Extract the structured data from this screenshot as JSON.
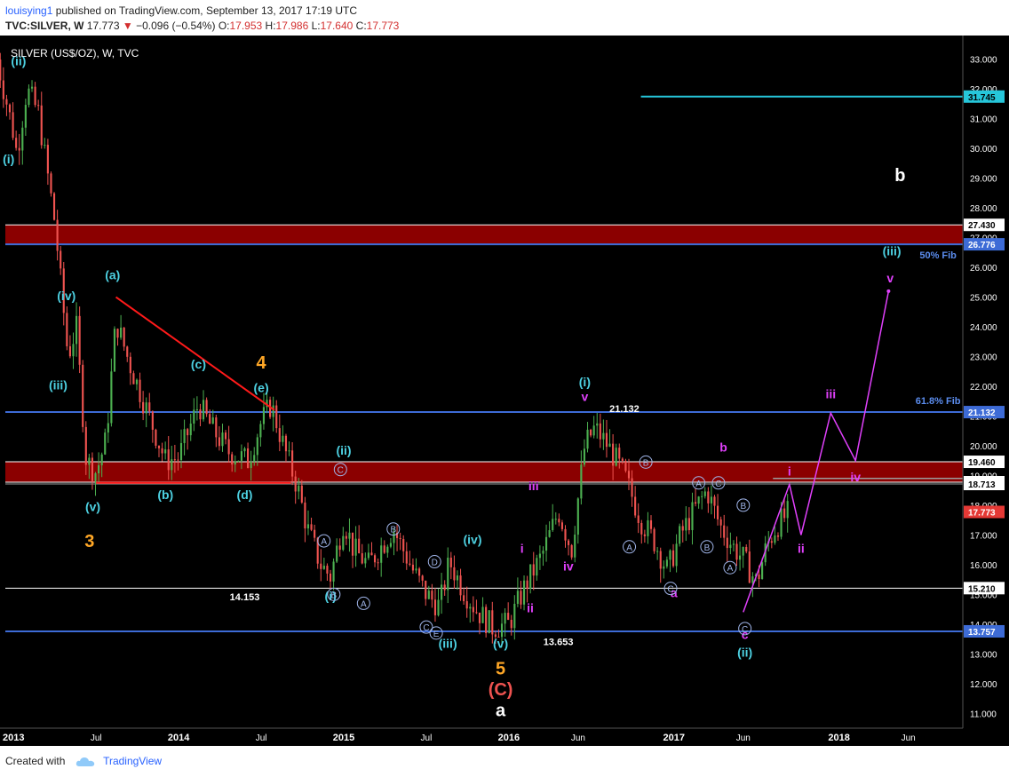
{
  "header": {
    "user": "louisying1",
    "published": "published on TradingView.com, September 13, 2017 17:19 UTC",
    "symbol": "TVC:SILVER, W",
    "last": "17.773",
    "change": "−0.096 (−0.54%)",
    "open_label": "O:",
    "open": "17.953",
    "high_label": "H:",
    "high": "17.986",
    "low_label": "L:",
    "low": "17.640",
    "close_label": "C:",
    "close": "17.773"
  },
  "footer": {
    "created_with": "Created with",
    "brand": "TradingView",
    "logo_icon": "tradingview-cloud-icon"
  },
  "colors": {
    "background": "#000000",
    "axis_text": "#ffffff",
    "up_candle": "#4caf50",
    "down_candle": "#ef5350",
    "wave_cyan": "#4dd0e1",
    "wave_magenta": "#e040fb",
    "wave_orange": "#ffa726",
    "wave_red": "#ef5350",
    "fib_blue": "#3d6bd6",
    "resistance_zone": "#8b0000",
    "trendline": "#ff1a1a",
    "target_line": "#26c6da"
  },
  "chart_data": {
    "type": "candlestick",
    "title": "SILVER (US$/OZ), W, TVC",
    "ylim": [
      10.5,
      33.5
    ],
    "y_ticks": [
      "11.000",
      "12.000",
      "13.000",
      "14.000",
      "15.000",
      "16.000",
      "17.000",
      "18.000",
      "19.000",
      "20.000",
      "21.000",
      "22.000",
      "23.000",
      "24.000",
      "25.000",
      "26.000",
      "27.000",
      "28.000",
      "29.000",
      "30.000",
      "31.000",
      "32.000",
      "33.000"
    ],
    "x_ticks": [
      {
        "label": "2013",
        "t": 2013.0
      },
      {
        "label": "Jul",
        "t": 2013.5
      },
      {
        "label": "2014",
        "t": 2014.0
      },
      {
        "label": "Jul",
        "t": 2014.5
      },
      {
        "label": "2015",
        "t": 2015.0
      },
      {
        "label": "Jul",
        "t": 2015.5
      },
      {
        "label": "2016",
        "t": 2016.0
      },
      {
        "label": "Jun",
        "t": 2016.42
      },
      {
        "label": "2017",
        "t": 2017.0
      },
      {
        "label": "Jun",
        "t": 2017.42
      },
      {
        "label": "2018",
        "t": 2018.0
      },
      {
        "label": "Jun",
        "t": 2018.42
      }
    ],
    "price_path": [
      [
        2012.9,
        33.0
      ],
      [
        2013.0,
        30.5
      ],
      [
        2013.02,
        29.8
      ],
      [
        2013.08,
        32.0
      ],
      [
        2013.15,
        31.2
      ],
      [
        2013.25,
        27.5
      ],
      [
        2013.33,
        23.0
      ],
      [
        2013.38,
        24.0
      ],
      [
        2013.44,
        19.5
      ],
      [
        2013.5,
        19.1
      ],
      [
        2013.56,
        20.2
      ],
      [
        2013.62,
        24.2
      ],
      [
        2013.7,
        22.8
      ],
      [
        2013.8,
        21.3
      ],
      [
        2013.92,
        19.5
      ],
      [
        2014.0,
        19.6
      ],
      [
        2014.12,
        21.4
      ],
      [
        2014.2,
        20.6
      ],
      [
        2014.3,
        19.8
      ],
      [
        2014.42,
        19.5
      ],
      [
        2014.5,
        20.8
      ],
      [
        2014.56,
        21.4
      ],
      [
        2014.64,
        19.9
      ],
      [
        2014.72,
        18.6
      ],
      [
        2014.78,
        17.2
      ],
      [
        2014.86,
        16.0
      ],
      [
        2014.92,
        15.6
      ],
      [
        2015.0,
        17.5
      ],
      [
        2015.06,
        16.5
      ],
      [
        2015.15,
        16.0
      ],
      [
        2015.3,
        17.2
      ],
      [
        2015.42,
        15.8
      ],
      [
        2015.5,
        15.0
      ],
      [
        2015.58,
        14.6
      ],
      [
        2015.64,
        16.1
      ],
      [
        2015.72,
        15.2
      ],
      [
        2015.8,
        14.5
      ],
      [
        2015.9,
        13.9
      ],
      [
        2016.0,
        14.0
      ],
      [
        2016.1,
        15.3
      ],
      [
        2016.2,
        16.3
      ],
      [
        2016.3,
        17.8
      ],
      [
        2016.38,
        16.5
      ],
      [
        2016.46,
        20.0
      ],
      [
        2016.52,
        20.6
      ],
      [
        2016.6,
        20.0
      ],
      [
        2016.7,
        19.0
      ],
      [
        2016.8,
        17.5
      ],
      [
        2016.88,
        16.8
      ],
      [
        2016.96,
        15.8
      ],
      [
        2017.04,
        17.0
      ],
      [
        2017.12,
        17.8
      ],
      [
        2017.2,
        18.5
      ],
      [
        2017.28,
        17.3
      ],
      [
        2017.36,
        16.6
      ],
      [
        2017.42,
        16.2
      ],
      [
        2017.5,
        15.4
      ],
      [
        2017.56,
        16.6
      ],
      [
        2017.62,
        17.3
      ],
      [
        2017.7,
        17.77
      ]
    ],
    "horizontal_levels": [
      {
        "id": "target",
        "value": 31.745,
        "label": "31.745",
        "style": "cyan",
        "from": 2016.8
      },
      {
        "id": "h27430",
        "value": 27.43,
        "label": "27.430",
        "style": "white"
      },
      {
        "id": "fib50",
        "value": 26.776,
        "label": "26.776",
        "style": "blue",
        "note": "50% Fib"
      },
      {
        "id": "fib618",
        "value": 21.132,
        "label": "21.132",
        "style": "blue",
        "note": "61.8% Fib"
      },
      {
        "id": "h19460",
        "value": 19.46,
        "label": "19.460",
        "style": "white"
      },
      {
        "id": "h18774",
        "value": 18.774,
        "label": "18.774",
        "style": "white"
      },
      {
        "id": "h18713",
        "value": 18.713,
        "label": "18.713",
        "style": "gray"
      },
      {
        "id": "last",
        "value": 17.773,
        "label": "17.773",
        "style": "red"
      },
      {
        "id": "h15210",
        "value": 15.21,
        "label": "15.210",
        "style": "white"
      },
      {
        "id": "h13757",
        "value": 13.757,
        "label": "13.757",
        "style": "blue"
      }
    ],
    "zones": [
      {
        "from": 26.776,
        "to": 27.43,
        "color": "#8b0000"
      },
      {
        "from": 18.774,
        "to": 19.46,
        "color": "#8b0000"
      }
    ],
    "trendlines": [
      {
        "points": [
          [
            2013.62,
            25.0
          ],
          [
            2014.58,
            21.2
          ]
        ],
        "color": "#ff1a1a"
      },
      {
        "points": [
          [
            2013.5,
            18.75
          ],
          [
            2014.68,
            18.75
          ]
        ],
        "color": "#ff1a1a"
      },
      {
        "points": [
          [
            2017.6,
            18.9
          ],
          [
            2018.9,
            18.9
          ]
        ],
        "color": "#9e9e9e"
      }
    ],
    "projection": [
      [
        2017.42,
        14.4
      ],
      [
        2017.7,
        18.7
      ],
      [
        2017.77,
        17.0
      ],
      [
        2017.95,
        21.1
      ],
      [
        2018.1,
        19.5
      ],
      [
        2018.3,
        25.2
      ]
    ],
    "value_labels": [
      {
        "text": "21.132",
        "t": 2016.7,
        "v": 21.13
      },
      {
        "text": "14.153",
        "t": 2014.4,
        "v": 14.8
      },
      {
        "text": "13.653",
        "t": 2016.3,
        "v": 13.3
      }
    ],
    "fib_notes": [
      {
        "text": "50% Fib",
        "t": 2018.6,
        "v": 26.3
      },
      {
        "text": "61.8% Fib",
        "t": 2018.6,
        "v": 21.4
      }
    ],
    "wave_labels": [
      {
        "text": "(ii)",
        "t": 2013.03,
        "v": 32.8,
        "c": "cyan"
      },
      {
        "text": "(i)",
        "t": 2012.97,
        "v": 29.5,
        "c": "cyan"
      },
      {
        "text": "(iv)",
        "t": 2013.32,
        "v": 24.9,
        "c": "cyan"
      },
      {
        "text": "(iii)",
        "t": 2013.27,
        "v": 21.9,
        "c": "cyan"
      },
      {
        "text": "(v)",
        "t": 2013.48,
        "v": 17.8,
        "c": "cyan"
      },
      {
        "text": "3",
        "t": 2013.46,
        "v": 16.6,
        "c": "orange",
        "big": true
      },
      {
        "text": "(a)",
        "t": 2013.6,
        "v": 25.6,
        "c": "cyan"
      },
      {
        "text": "(b)",
        "t": 2013.92,
        "v": 18.2,
        "c": "cyan"
      },
      {
        "text": "(c)",
        "t": 2014.12,
        "v": 22.6,
        "c": "cyan"
      },
      {
        "text": "(d)",
        "t": 2014.4,
        "v": 18.2,
        "c": "cyan"
      },
      {
        "text": "(e)",
        "t": 2014.5,
        "v": 21.8,
        "c": "cyan"
      },
      {
        "text": "4",
        "t": 2014.5,
        "v": 22.6,
        "c": "orange",
        "big": true
      },
      {
        "text": "(ii)",
        "t": 2015.0,
        "v": 19.7,
        "c": "cyan"
      },
      {
        "text": "(i)",
        "t": 2014.92,
        "v": 14.8,
        "c": "cyan"
      },
      {
        "text": "(iv)",
        "t": 2015.78,
        "v": 16.7,
        "c": "cyan"
      },
      {
        "text": "(iii)",
        "t": 2015.63,
        "v": 13.2,
        "c": "cyan"
      },
      {
        "text": "(v)",
        "t": 2015.95,
        "v": 13.2,
        "c": "cyan"
      },
      {
        "text": "5",
        "t": 2015.95,
        "v": 12.3,
        "c": "orange",
        "big": true
      },
      {
        "text": "(C)",
        "t": 2015.95,
        "v": 11.6,
        "c": "red",
        "big": true
      },
      {
        "text": "a",
        "t": 2015.95,
        "v": 10.9,
        "c": "white",
        "big": true
      },
      {
        "text": "i",
        "t": 2016.08,
        "v": 16.4,
        "c": "magenta"
      },
      {
        "text": "ii",
        "t": 2016.13,
        "v": 14.4,
        "c": "magenta"
      },
      {
        "text": "iii",
        "t": 2016.15,
        "v": 18.5,
        "c": "magenta"
      },
      {
        "text": "iv",
        "t": 2016.36,
        "v": 15.8,
        "c": "magenta"
      },
      {
        "text": "(i)",
        "t": 2016.46,
        "v": 22.0,
        "c": "cyan"
      },
      {
        "text": "v",
        "t": 2016.46,
        "v": 21.5,
        "c": "magenta"
      },
      {
        "text": "a",
        "t": 2017.0,
        "v": 14.9,
        "c": "magenta"
      },
      {
        "text": "b",
        "t": 2017.3,
        "v": 19.8,
        "c": "magenta"
      },
      {
        "text": "c",
        "t": 2017.43,
        "v": 13.5,
        "c": "magenta"
      },
      {
        "text": "(ii)",
        "t": 2017.43,
        "v": 12.9,
        "c": "cyan"
      },
      {
        "text": "i",
        "t": 2017.7,
        "v": 19.0,
        "c": "magenta"
      },
      {
        "text": "ii",
        "t": 2017.77,
        "v": 16.4,
        "c": "magenta"
      },
      {
        "text": "iii",
        "t": 2017.95,
        "v": 21.6,
        "c": "magenta"
      },
      {
        "text": "iv",
        "t": 2018.1,
        "v": 18.8,
        "c": "magenta"
      },
      {
        "text": "(iii)",
        "t": 2018.32,
        "v": 26.4,
        "c": "cyan"
      },
      {
        "text": "v",
        "t": 2018.31,
        "v": 25.5,
        "c": "magenta"
      },
      {
        "text": "b",
        "t": 2018.37,
        "v": 28.9,
        "c": "white",
        "big": true
      }
    ],
    "circle_labels": [
      {
        "text": "C",
        "t": 2014.98,
        "v": 19.2
      },
      {
        "text": "A",
        "t": 2014.88,
        "v": 16.8
      },
      {
        "text": "B",
        "t": 2014.94,
        "v": 15.0
      },
      {
        "text": "A",
        "t": 2015.12,
        "v": 14.7
      },
      {
        "text": "B",
        "t": 2015.3,
        "v": 17.2
      },
      {
        "text": "D",
        "t": 2015.55,
        "v": 16.1
      },
      {
        "text": "C",
        "t": 2015.5,
        "v": 13.9
      },
      {
        "text": "E",
        "t": 2015.56,
        "v": 13.7
      },
      {
        "text": "B",
        "t": 2016.83,
        "v": 19.45
      },
      {
        "text": "A",
        "t": 2016.73,
        "v": 16.6
      },
      {
        "text": "C",
        "t": 2016.98,
        "v": 15.2
      },
      {
        "text": "A",
        "t": 2017.15,
        "v": 18.75
      },
      {
        "text": "C",
        "t": 2017.27,
        "v": 18.75
      },
      {
        "text": "B",
        "t": 2017.2,
        "v": 16.6
      },
      {
        "text": "B",
        "t": 2017.42,
        "v": 18.0
      },
      {
        "text": "A",
        "t": 2017.34,
        "v": 15.9
      },
      {
        "text": "C",
        "t": 2017.43,
        "v": 13.85
      }
    ]
  }
}
